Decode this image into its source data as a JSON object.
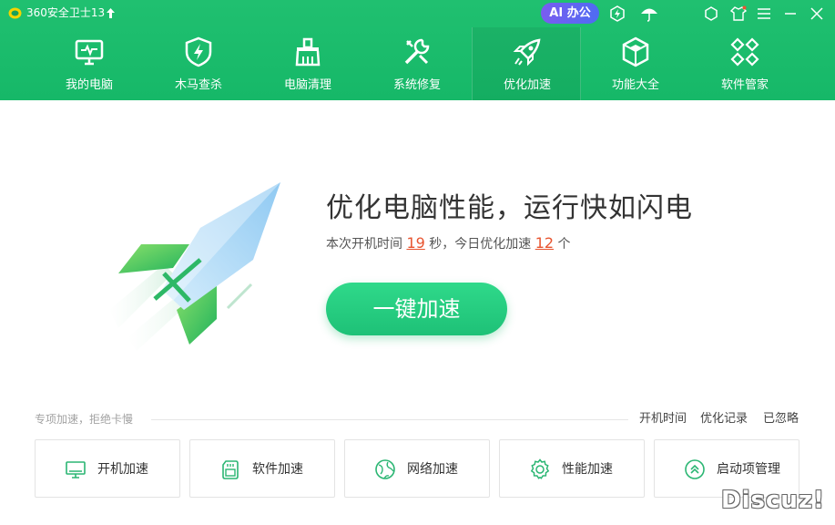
{
  "window": {
    "title": "360安全卫士13"
  },
  "titlebar": {
    "ai_label": "AI 办公",
    "icons": [
      "update-arrow-icon",
      "shield-badge-icon",
      "umbrella-icon",
      "settings-icon",
      "skin-icon",
      "menu-icon",
      "minimize-icon",
      "close-icon"
    ]
  },
  "nav": {
    "items": [
      {
        "label": "我的电脑",
        "icon": "monitor-icon"
      },
      {
        "label": "木马查杀",
        "icon": "shield-bolt-icon"
      },
      {
        "label": "电脑清理",
        "icon": "broom-icon"
      },
      {
        "label": "系统修复",
        "icon": "wrench-icon"
      },
      {
        "label": "优化加速",
        "icon": "rocket-icon",
        "active": true
      },
      {
        "label": "功能大全",
        "icon": "cube-icon"
      },
      {
        "label": "软件管家",
        "icon": "apps-icon"
      }
    ]
  },
  "hero": {
    "title": "优化电脑性能，运行快如闪电",
    "stats_prefix": "本次开机时间 ",
    "boot_seconds": "19",
    "stats_middle": " 秒，今日优化加速 ",
    "optimized_count": "12",
    "stats_suffix": " 个",
    "button_label": "一键加速"
  },
  "section": {
    "label": "专项加速，拒绝卡慢",
    "links": [
      "开机时间",
      "优化记录",
      "已忽略"
    ]
  },
  "cards": [
    {
      "label": "开机加速",
      "icon": "monitor-outline-icon"
    },
    {
      "label": "软件加速",
      "icon": "sdcard-icon"
    },
    {
      "label": "网络加速",
      "icon": "globe-icon"
    },
    {
      "label": "性能加速",
      "icon": "gear-icon"
    },
    {
      "label": "启动项管理",
      "icon": "chevron-up-circle-icon"
    }
  ],
  "watermark": "Discuz!",
  "colors": {
    "brand_green": "#1fbd6e",
    "highlight": "#e8542f",
    "ai_gradient_start": "#7a5cf0",
    "ai_gradient_end": "#4e6cf2"
  }
}
